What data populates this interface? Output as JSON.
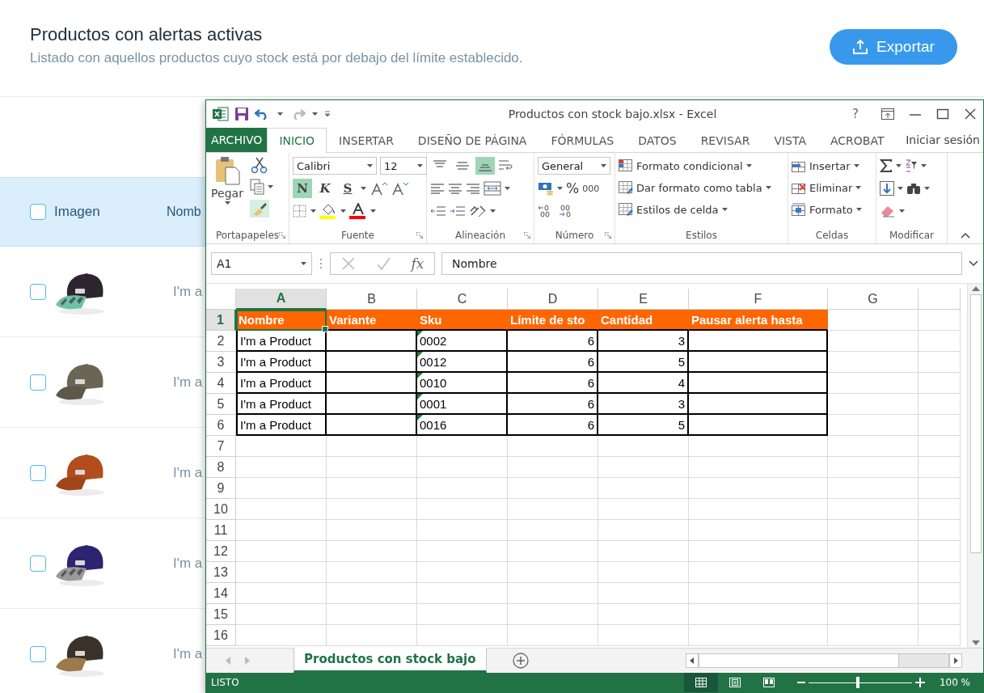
{
  "page": {
    "title": "Productos con alertas activas",
    "subtitle": "Listado con aquellos productos cuyo stock está por debajo del límite establecido.",
    "export_button": "Exportar"
  },
  "product_table": {
    "header": {
      "checked": false,
      "columns": [
        "Imagen",
        "Nomb"
      ]
    },
    "rows": [
      {
        "checked": false,
        "name": "I'm a"
      },
      {
        "checked": false,
        "name": "I'm a"
      },
      {
        "checked": false,
        "name": "I'm a"
      },
      {
        "checked": false,
        "name": "I'm a"
      },
      {
        "checked": false,
        "name": "I'm a"
      }
    ]
  },
  "excel": {
    "title": "Productos con stock bajo.xlsx - Excel",
    "help": "?",
    "file_tab": "ARCHIVO",
    "tabs": [
      {
        "label": "INICIO",
        "selected": true
      },
      {
        "label": "INSERTAR",
        "selected": false
      },
      {
        "label": "DISEÑO DE PÁGINA",
        "selected": false
      },
      {
        "label": "FÓRMULAS",
        "selected": false
      },
      {
        "label": "DATOS",
        "selected": false
      },
      {
        "label": "REVISAR",
        "selected": false
      },
      {
        "label": "VISTA",
        "selected": false
      },
      {
        "label": "ACROBAT",
        "selected": false
      }
    ],
    "account": "Iniciar sesión",
    "ribbon": {
      "clipboard": {
        "paste": "Pegar",
        "label": "Portapapeles"
      },
      "font": {
        "family": "Calibri",
        "size": "12",
        "label": "Fuente",
        "styles": [
          {
            "label": "N",
            "kind": "bold",
            "selected": true
          },
          {
            "label": "K",
            "kind": "italic",
            "selected": false
          },
          {
            "label": "S",
            "kind": "underline",
            "selected": false
          }
        ]
      },
      "alignment": {
        "label": "Alineación",
        "vertical": [
          {
            "selected": false
          },
          {
            "selected": false
          },
          {
            "selected": true
          }
        ]
      },
      "number": {
        "format": "General",
        "percent": "%",
        "thousands": "000",
        "label": "Número"
      },
      "styles": {
        "label": "Estilos",
        "commands": [
          "Formato condicional",
          "Dar formato como tabla",
          "Estilos de celda"
        ]
      },
      "cells": {
        "label": "Celdas",
        "commands": [
          "Insertar",
          "Eliminar",
          "Formato"
        ]
      },
      "editing": {
        "label": "Modificar"
      }
    },
    "name_box": "A1",
    "function_label": "fx",
    "formula": "Nombre",
    "sheet": {
      "columns": [
        {
          "letter": "A",
          "selected": true
        },
        {
          "letter": "B",
          "selected": false
        },
        {
          "letter": "C",
          "selected": false
        },
        {
          "letter": "D",
          "selected": false
        },
        {
          "letter": "E",
          "selected": false
        },
        {
          "letter": "F",
          "selected": false
        },
        {
          "letter": "G",
          "selected": false
        }
      ],
      "header_row": {
        "number": "1",
        "selected": true,
        "cells": [
          "Nombre",
          "Variante",
          "Sku",
          "Límite de sto",
          "Cantidad",
          "Pausar alerta hasta"
        ]
      },
      "records": [
        {
          "number": "2",
          "nombre": "I'm a Product",
          "sku": "0002",
          "limite": "6",
          "cantidad": "3",
          "warning": true
        },
        {
          "number": "3",
          "nombre": "I'm a Product",
          "sku": "0012",
          "limite": "6",
          "cantidad": "5",
          "warning": true
        },
        {
          "number": "4",
          "nombre": "I'm a Product",
          "sku": "0010",
          "limite": "6",
          "cantidad": "4",
          "warning": true
        },
        {
          "number": "5",
          "nombre": "I'm a Product",
          "sku": "0001",
          "limite": "6",
          "cantidad": "3",
          "warning": true
        },
        {
          "number": "6",
          "nombre": "I'm a Product",
          "sku": "0016",
          "limite": "6",
          "cantidad": "5",
          "warning": true
        }
      ],
      "empty_rows": [
        "7",
        "8",
        "9",
        "10",
        "11",
        "12",
        "13",
        "14",
        "15",
        "16"
      ]
    },
    "sheet_tabs": [
      {
        "label": "Productos con stock bajo",
        "selected": true
      }
    ],
    "status": "LISTO",
    "views": [
      {
        "kind": "normal",
        "selected": true
      },
      {
        "kind": "page-layout",
        "selected": false
      },
      {
        "kind": "page-break",
        "selected": false
      }
    ],
    "zoom": {
      "level": 0.48,
      "reading": "100 %"
    }
  }
}
